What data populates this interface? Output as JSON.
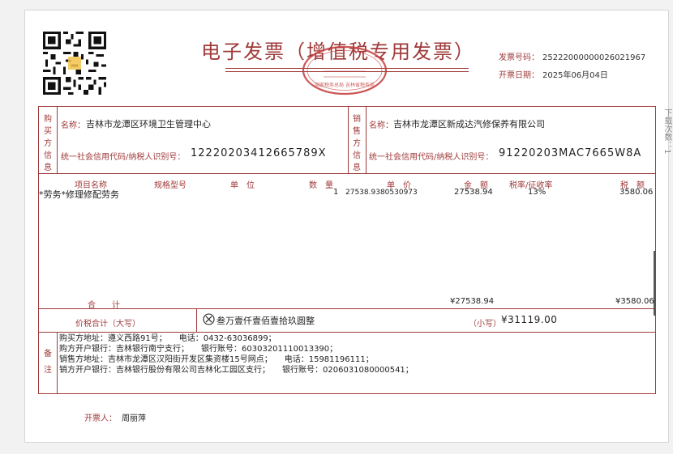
{
  "invoice": {
    "title": "电子发票（增值税专用发票）",
    "number_label": "发票号码：",
    "number": "25222000000026021967",
    "date_label": "开票日期：",
    "date": "2025年06月04日",
    "side_text": "下载次数：1",
    "seal_text": "国家税务总局 吉林省税务局",
    "seal_color": "#c43a3a"
  },
  "buyer": {
    "section_label": "购买方信息",
    "name_label": "名称：",
    "name": "吉林市龙潭区环境卫生管理中心",
    "tax_label": "统一社会信用代码/纳税人识别号：",
    "tax_id": "12220203412665789X"
  },
  "seller": {
    "section_label": "销售方信息",
    "name_label": "名称：",
    "name": "吉林市龙潭区新成达汽修保养有限公司",
    "tax_label": "统一社会信用代码/纳税人识别号：",
    "tax_id": "91220203MAC7665W8A"
  },
  "items": {
    "headers": [
      "项目名称",
      "规格型号",
      "单　位",
      "数　量",
      "单　价",
      "金　额",
      "税率/征收率",
      "税　额"
    ],
    "rows": [
      {
        "name": "*劳务*修理修配劳务",
        "spec": "",
        "unit": "",
        "qty": "1",
        "price": "27538.9380530973",
        "amount": "27538.94",
        "rate": "13%",
        "tax": "3580.06"
      }
    ]
  },
  "totals": {
    "label": "合　　计",
    "amount": "¥27538.94",
    "tax": "¥3580.06",
    "words_label": "价税合计（大写）",
    "words": "叁万壹仟壹佰壹拾玖圆整",
    "small_label": "（小写）",
    "small": "¥31119.00"
  },
  "remarks": {
    "label": "备注",
    "lines": [
      "购买方地址：遵义西路91号；　　电话：0432-63036899；",
      "购方开户银行：吉林银行南宁支行；　　银行账号：60303201110013390；",
      "销售方地址：吉林市龙潭区汉阳街开发区集资楼15号网点；　　电话：15981196111；",
      "销方开户银行：吉林银行股份有限公司吉林化工园区支行；　　银行账号：0206031080000541；"
    ]
  },
  "issuer": {
    "label": "开票人：",
    "name": "周丽萍"
  }
}
